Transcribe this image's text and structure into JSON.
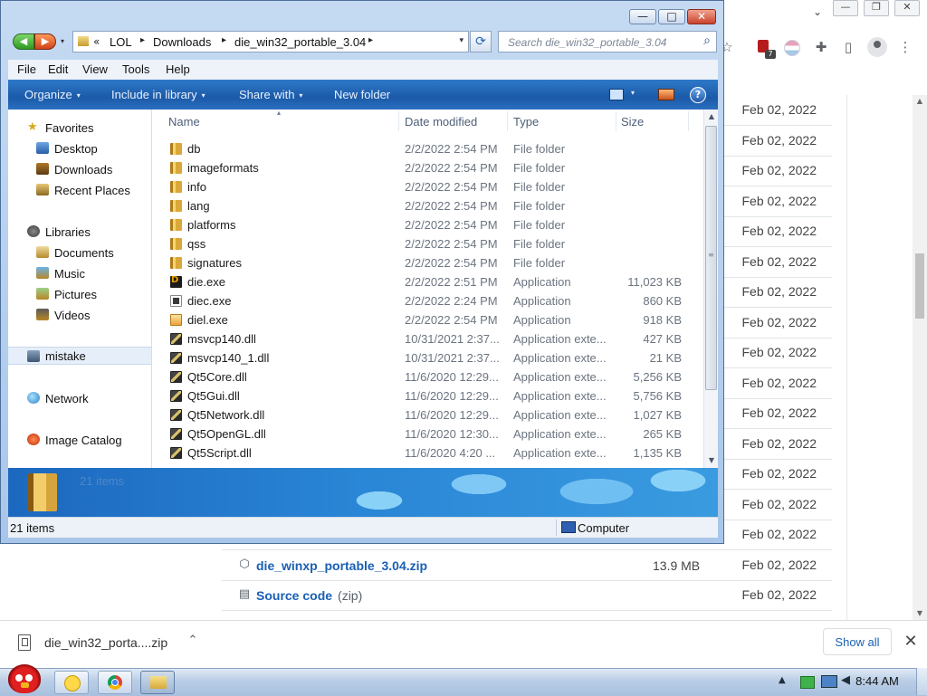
{
  "chrome": {
    "tab_caret": "⌄",
    "window_controls": [
      "—",
      "❐",
      "✕"
    ],
    "toolbar_icons": {
      "star": "☆",
      "extension_count": "7",
      "puzzle": "✚",
      "sidepanel": "▯",
      "menu": "⋮"
    },
    "releases": {
      "rows_above": [
        {
          "date": "Feb 02, 2022"
        },
        {
          "date": "Feb 02, 2022"
        },
        {
          "date": "Feb 02, 2022"
        },
        {
          "date": "Feb 02, 2022"
        },
        {
          "date": "Feb 02, 2022"
        },
        {
          "date": "Feb 02, 2022"
        },
        {
          "date": "Feb 02, 2022"
        },
        {
          "date": "Feb 02, 2022"
        },
        {
          "date": "Feb 02, 2022"
        },
        {
          "date": "Feb 02, 2022"
        },
        {
          "date": "Feb 02, 2022"
        },
        {
          "date": "Feb 02, 2022"
        },
        {
          "date": "Feb 02, 2022"
        },
        {
          "date": "Feb 02, 2022"
        },
        {
          "date": "Feb 02, 2022"
        }
      ],
      "asset_zip": {
        "name": "die_winxp_portable_3.04.zip",
        "size": "13.9 MB",
        "date": "Feb 02, 2022"
      },
      "source_code": {
        "name": "Source code",
        "suffix": "(zip)",
        "date": "Feb 02, 2022"
      }
    },
    "download_shelf": {
      "file_name": "die_win32_porta....zip",
      "chevron": "⌃",
      "show_all": "Show all",
      "close": "✕"
    }
  },
  "explorer": {
    "caption_buttons": {
      "minimize": "—",
      "maximize": "□",
      "close": "✕"
    },
    "nav": {
      "back": "◀",
      "forward": "▶",
      "history": "▾"
    },
    "breadcrumb": {
      "overflow": "«",
      "parts": [
        "LOL",
        "Downloads",
        "die_win32_portable_3.04"
      ],
      "sep": "▸",
      "dropdown": "▾",
      "refresh": "⟳"
    },
    "search": {
      "placeholder": "Search die_win32_portable_3.04",
      "glass": "⌕"
    },
    "menu": [
      "File",
      "Edit",
      "View",
      "Tools",
      "Help"
    ],
    "commands": {
      "organize": "Organize",
      "include_in_library": "Include in library",
      "share_with": "Share with",
      "new_folder": "New folder",
      "dd": "▾",
      "help": "?"
    },
    "nav_pane": {
      "favorites": "Favorites",
      "desktop": "Desktop",
      "downloads": "Downloads",
      "recent_places": "Recent Places",
      "libraries": "Libraries",
      "documents": "Documents",
      "music": "Music",
      "pictures": "Pictures",
      "videos": "Videos",
      "mistake": "mistake",
      "network": "Network",
      "image_catalog": "Image Catalog"
    },
    "columns": {
      "name": "Name",
      "date_modified": "Date modified",
      "type": "Type",
      "size": "Size",
      "sort_arrow": "▴"
    },
    "files": [
      {
        "name": "db",
        "date": "2/2/2022 2:54 PM",
        "type": "File folder",
        "size": "",
        "icon": "folder"
      },
      {
        "name": "imageformats",
        "date": "2/2/2022 2:54 PM",
        "type": "File folder",
        "size": "",
        "icon": "folder"
      },
      {
        "name": "info",
        "date": "2/2/2022 2:54 PM",
        "type": "File folder",
        "size": "",
        "icon": "folder"
      },
      {
        "name": "lang",
        "date": "2/2/2022 2:54 PM",
        "type": "File folder",
        "size": "",
        "icon": "folder"
      },
      {
        "name": "platforms",
        "date": "2/2/2022 2:54 PM",
        "type": "File folder",
        "size": "",
        "icon": "folder"
      },
      {
        "name": "qss",
        "date": "2/2/2022 2:54 PM",
        "type": "File folder",
        "size": "",
        "icon": "folder"
      },
      {
        "name": "signatures",
        "date": "2/2/2022 2:54 PM",
        "type": "File folder",
        "size": "",
        "icon": "folder"
      },
      {
        "name": "die.exe",
        "date": "2/2/2022 2:51 PM",
        "type": "Application",
        "size": "11,023 KB",
        "icon": "app-die"
      },
      {
        "name": "diec.exe",
        "date": "2/2/2022 2:24 PM",
        "type": "Application",
        "size": "860 KB",
        "icon": "app-gen"
      },
      {
        "name": "diel.exe",
        "date": "2/2/2022 2:54 PM",
        "type": "Application",
        "size": "918 KB",
        "icon": "app-diel"
      },
      {
        "name": "msvcp140.dll",
        "date": "10/31/2021 2:37...",
        "type": "Application exte...",
        "size": "427 KB",
        "icon": "dll"
      },
      {
        "name": "msvcp140_1.dll",
        "date": "10/31/2021 2:37...",
        "type": "Application exte...",
        "size": "21 KB",
        "icon": "dll"
      },
      {
        "name": "Qt5Core.dll",
        "date": "11/6/2020 12:29...",
        "type": "Application exte...",
        "size": "5,256 KB",
        "icon": "dll"
      },
      {
        "name": "Qt5Gui.dll",
        "date": "11/6/2020 12:29...",
        "type": "Application exte...",
        "size": "5,756 KB",
        "icon": "dll"
      },
      {
        "name": "Qt5Network.dll",
        "date": "11/6/2020 12:29...",
        "type": "Application exte...",
        "size": "1,027 KB",
        "icon": "dll"
      },
      {
        "name": "Qt5OpenGL.dll",
        "date": "11/6/2020 12:30...",
        "type": "Application exte...",
        "size": "265 KB",
        "icon": "dll"
      },
      {
        "name": "Qt5Script.dll",
        "date": "11/6/2020 4:20 ...",
        "type": "Application exte...",
        "size": "1,135 KB",
        "icon": "dll"
      }
    ],
    "scroll": {
      "up": "▲",
      "down": "▼",
      "grip": "≡"
    },
    "details_count": "21 items",
    "status": {
      "items": "21 items",
      "location": "Computer"
    }
  },
  "taskbar": {
    "tray_arrow": "▲",
    "volume": "◀",
    "clock": "8:44 AM"
  }
}
